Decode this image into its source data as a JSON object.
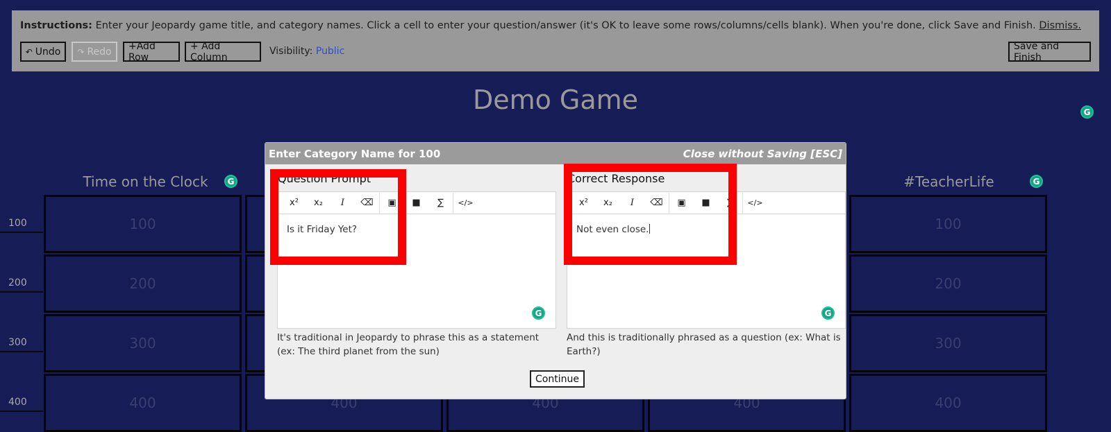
{
  "instructions": {
    "label": "Instructions:",
    "text": " Enter your Jeopardy game title, and category names. Click a cell to enter your question/answer (it's OK to leave some rows/columns/cells blank). When you're done, click Save and Finish. ",
    "dismiss": "Dismiss.",
    "undo": "Undo",
    "redo": "Redo",
    "add_row": "+Add Row",
    "add_column": "+ Add Column",
    "visibility_label": "Visibility:",
    "visibility_value": "Public",
    "save_finish": "Save and Finish"
  },
  "board": {
    "title": "Demo Game",
    "categories": [
      "Time on the Clock",
      "#TeacherLife"
    ],
    "rows": [
      "100",
      "200",
      "300",
      "400"
    ],
    "cells": {
      "c1": [
        "100",
        "200",
        "300",
        "400"
      ],
      "c2": [
        "400"
      ],
      "c3": [
        "400"
      ],
      "c4": [
        "400"
      ],
      "c5": [
        "100",
        "200",
        "300",
        "400"
      ]
    }
  },
  "modal": {
    "title": "Enter Category Name for 100",
    "close": "Close without Saving [ESC]",
    "question_label": "Question Prompt",
    "question_value": "Is it Friday Yet?",
    "question_hint": "It's traditional in Jeopardy to phrase this as a statement (ex: The third planet from the sun)",
    "response_label": "Correct Response",
    "response_value": "Not even close.",
    "response_hint": "And this is traditionally phrased as a question (ex: What is Earth?)",
    "continue": "Continue"
  },
  "editor_toolbar": {
    "superscript": "x²",
    "subscript": "x₂",
    "italic": "I",
    "eraser": "⌫",
    "image": "▣",
    "video": "■",
    "sigma": "∑",
    "code": "</>"
  },
  "grammarly_glyph": "G",
  "colors": {
    "background": "#161c56",
    "highlight": "#ff0000",
    "link": "#2d4fc0"
  }
}
